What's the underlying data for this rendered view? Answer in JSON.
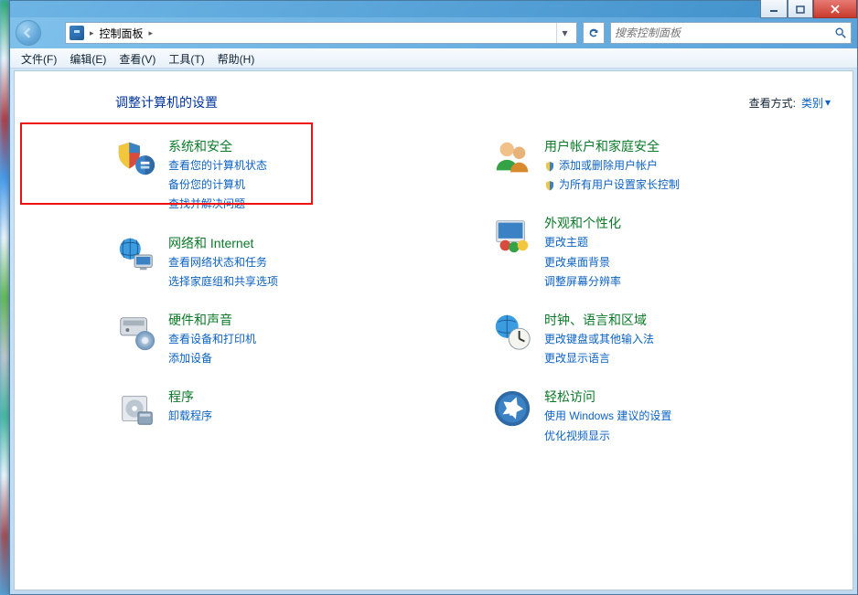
{
  "breadcrumb": {
    "root": "控制面板"
  },
  "search": {
    "placeholder": "搜索控制面板"
  },
  "menus": {
    "file": "文件(F)",
    "edit": "编辑(E)",
    "view": "查看(V)",
    "tools": "工具(T)",
    "help": "帮助(H)"
  },
  "heading": "调整计算机的设置",
  "viewby": {
    "label": "查看方式:",
    "value": "类别"
  },
  "categories": {
    "left": [
      {
        "id": "system-security",
        "title": "系统和安全",
        "links": [
          {
            "t": "查看您的计算机状态"
          },
          {
            "t": "备份您的计算机"
          },
          {
            "t": "查找并解决问题"
          }
        ]
      },
      {
        "id": "network-internet",
        "title": "网络和 Internet",
        "links": [
          {
            "t": "查看网络状态和任务"
          },
          {
            "t": "选择家庭组和共享选项"
          }
        ]
      },
      {
        "id": "hardware-sound",
        "title": "硬件和声音",
        "links": [
          {
            "t": "查看设备和打印机"
          },
          {
            "t": "添加设备"
          }
        ]
      },
      {
        "id": "programs",
        "title": "程序",
        "links": [
          {
            "t": "卸载程序"
          }
        ]
      }
    ],
    "right": [
      {
        "id": "user-accounts",
        "title": "用户帐户和家庭安全",
        "links": [
          {
            "t": "添加或删除用户帐户",
            "shield": true
          },
          {
            "t": "为所有用户设置家长控制",
            "shield": true
          }
        ]
      },
      {
        "id": "appearance",
        "title": "外观和个性化",
        "links": [
          {
            "t": "更改主题"
          },
          {
            "t": "更改桌面背景"
          },
          {
            "t": "调整屏幕分辨率"
          }
        ]
      },
      {
        "id": "clock-language",
        "title": "时钟、语言和区域",
        "links": [
          {
            "t": "更改键盘或其他输入法"
          },
          {
            "t": "更改显示语言"
          }
        ]
      },
      {
        "id": "ease-of-access",
        "title": "轻松访问",
        "links": [
          {
            "t": "使用 Windows 建议的设置"
          },
          {
            "t": "优化视频显示"
          }
        ]
      }
    ]
  }
}
